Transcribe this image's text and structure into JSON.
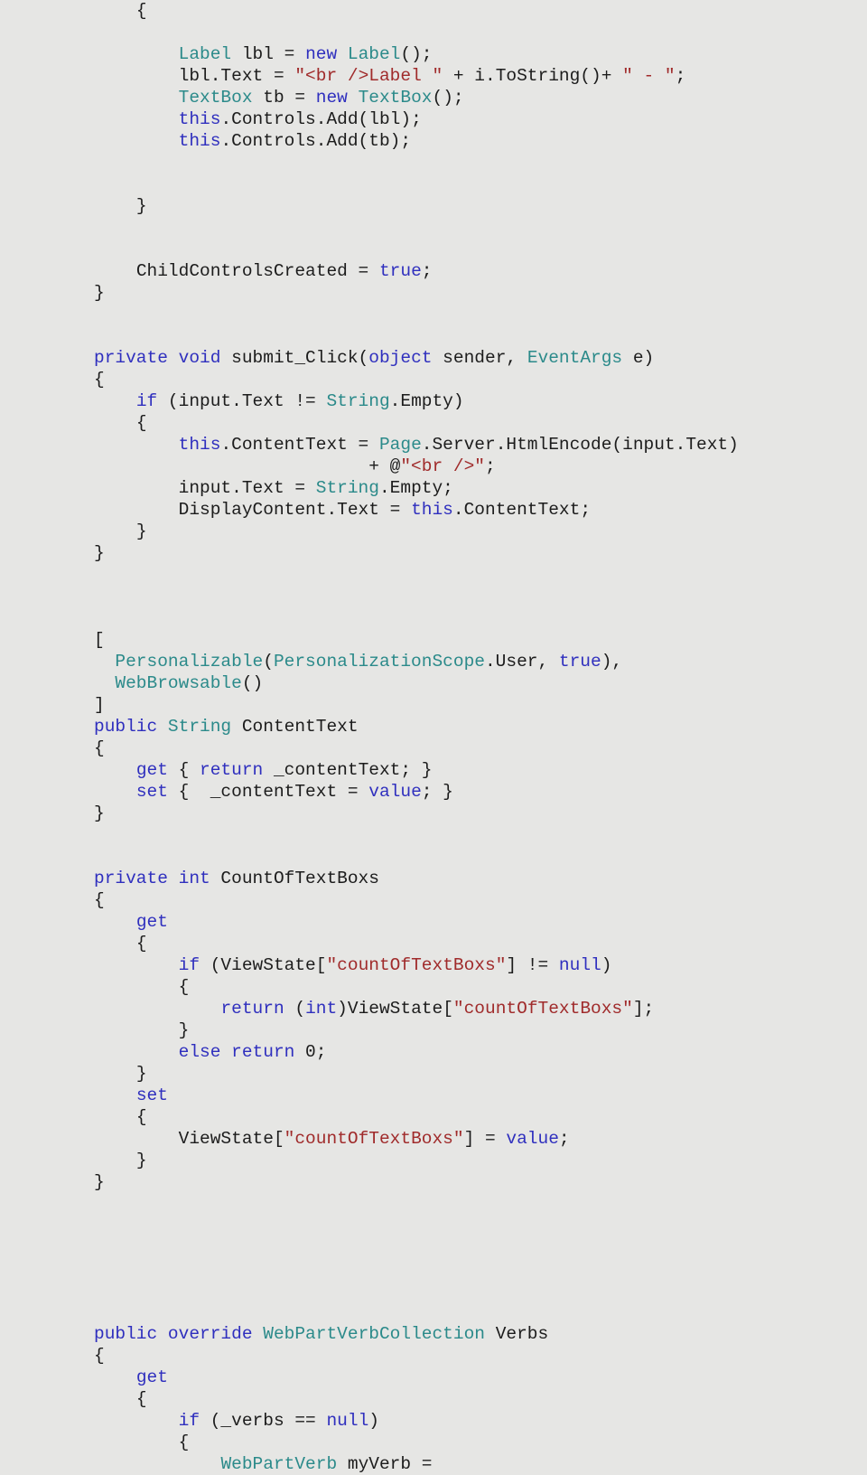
{
  "document": {
    "kind": "source-code-listing",
    "language": "C#",
    "background_color": "#e6e6e4",
    "colors": {
      "plain": "#1c1c1c",
      "keyword": "#2f2fbe",
      "type": "#2b8a8a",
      "string": "#a02b2b"
    }
  },
  "code": {
    "lines": [
      {
        "indent": 4,
        "tokens": [
          {
            "t": "{",
            "c": "plain"
          }
        ]
      },
      {
        "indent": 0,
        "tokens": []
      },
      {
        "indent": 8,
        "tokens": [
          {
            "t": "Label",
            "c": "type"
          },
          {
            "t": " lbl = ",
            "c": "plain"
          },
          {
            "t": "new",
            "c": "keyword"
          },
          {
            "t": " ",
            "c": "plain"
          },
          {
            "t": "Label",
            "c": "type"
          },
          {
            "t": "();",
            "c": "plain"
          }
        ]
      },
      {
        "indent": 8,
        "tokens": [
          {
            "t": "lbl.Text = ",
            "c": "plain"
          },
          {
            "t": "\"<br />Label \"",
            "c": "string"
          },
          {
            "t": " + i.ToString()+ ",
            "c": "plain"
          },
          {
            "t": "\" - \"",
            "c": "string"
          },
          {
            "t": ";",
            "c": "plain"
          }
        ]
      },
      {
        "indent": 8,
        "tokens": [
          {
            "t": "TextBox",
            "c": "type"
          },
          {
            "t": " tb = ",
            "c": "plain"
          },
          {
            "t": "new",
            "c": "keyword"
          },
          {
            "t": " ",
            "c": "plain"
          },
          {
            "t": "TextBox",
            "c": "type"
          },
          {
            "t": "();",
            "c": "plain"
          }
        ]
      },
      {
        "indent": 8,
        "tokens": [
          {
            "t": "this",
            "c": "keyword"
          },
          {
            "t": ".Controls.Add(lbl);",
            "c": "plain"
          }
        ]
      },
      {
        "indent": 8,
        "tokens": [
          {
            "t": "this",
            "c": "keyword"
          },
          {
            "t": ".Controls.Add(tb);",
            "c": "plain"
          }
        ]
      },
      {
        "indent": 0,
        "tokens": []
      },
      {
        "indent": 0,
        "tokens": []
      },
      {
        "indent": 4,
        "tokens": [
          {
            "t": "}",
            "c": "plain"
          }
        ]
      },
      {
        "indent": 0,
        "tokens": []
      },
      {
        "indent": 0,
        "tokens": []
      },
      {
        "indent": 4,
        "tokens": [
          {
            "t": "ChildControlsCreated = ",
            "c": "plain"
          },
          {
            "t": "true",
            "c": "keyword"
          },
          {
            "t": ";",
            "c": "plain"
          }
        ]
      },
      {
        "indent": 0,
        "tokens": [
          {
            "t": "}",
            "c": "plain"
          }
        ]
      },
      {
        "indent": 0,
        "tokens": []
      },
      {
        "indent": 0,
        "tokens": []
      },
      {
        "indent": 0,
        "tokens": [
          {
            "t": "private",
            "c": "keyword"
          },
          {
            "t": " ",
            "c": "plain"
          },
          {
            "t": "void",
            "c": "keyword"
          },
          {
            "t": " submit_Click(",
            "c": "plain"
          },
          {
            "t": "object",
            "c": "keyword"
          },
          {
            "t": " sender, ",
            "c": "plain"
          },
          {
            "t": "EventArgs",
            "c": "type"
          },
          {
            "t": " e)",
            "c": "plain"
          }
        ]
      },
      {
        "indent": 0,
        "tokens": [
          {
            "t": "{",
            "c": "plain"
          }
        ]
      },
      {
        "indent": 4,
        "tokens": [
          {
            "t": "if",
            "c": "keyword"
          },
          {
            "t": " (input.Text != ",
            "c": "plain"
          },
          {
            "t": "String",
            "c": "type"
          },
          {
            "t": ".Empty)",
            "c": "plain"
          }
        ]
      },
      {
        "indent": 4,
        "tokens": [
          {
            "t": "{",
            "c": "plain"
          }
        ]
      },
      {
        "indent": 8,
        "tokens": [
          {
            "t": "this",
            "c": "keyword"
          },
          {
            "t": ".ContentText = ",
            "c": "plain"
          },
          {
            "t": "Page",
            "c": "type"
          },
          {
            "t": ".Server.HtmlEncode(input.Text)",
            "c": "plain"
          }
        ]
      },
      {
        "indent": 26,
        "tokens": [
          {
            "t": "+ @",
            "c": "plain"
          },
          {
            "t": "\"<br />\"",
            "c": "string"
          },
          {
            "t": ";",
            "c": "plain"
          }
        ]
      },
      {
        "indent": 8,
        "tokens": [
          {
            "t": "input.Text = ",
            "c": "plain"
          },
          {
            "t": "String",
            "c": "type"
          },
          {
            "t": ".Empty;",
            "c": "plain"
          }
        ]
      },
      {
        "indent": 8,
        "tokens": [
          {
            "t": "DisplayContent.Text = ",
            "c": "plain"
          },
          {
            "t": "this",
            "c": "keyword"
          },
          {
            "t": ".ContentText;",
            "c": "plain"
          }
        ]
      },
      {
        "indent": 4,
        "tokens": [
          {
            "t": "}",
            "c": "plain"
          }
        ]
      },
      {
        "indent": 0,
        "tokens": [
          {
            "t": "}",
            "c": "plain"
          }
        ]
      },
      {
        "indent": 0,
        "tokens": []
      },
      {
        "indent": 0,
        "tokens": []
      },
      {
        "indent": 0,
        "tokens": []
      },
      {
        "indent": 0,
        "tokens": [
          {
            "t": "[",
            "c": "plain"
          }
        ]
      },
      {
        "indent": 2,
        "tokens": [
          {
            "t": "Personalizable",
            "c": "type"
          },
          {
            "t": "(",
            "c": "plain"
          },
          {
            "t": "PersonalizationScope",
            "c": "type"
          },
          {
            "t": ".User, ",
            "c": "plain"
          },
          {
            "t": "true",
            "c": "keyword"
          },
          {
            "t": "),",
            "c": "plain"
          }
        ]
      },
      {
        "indent": 2,
        "tokens": [
          {
            "t": "WebBrowsable",
            "c": "type"
          },
          {
            "t": "()",
            "c": "plain"
          }
        ]
      },
      {
        "indent": 0,
        "tokens": [
          {
            "t": "]",
            "c": "plain"
          }
        ]
      },
      {
        "indent": 0,
        "tokens": [
          {
            "t": "public",
            "c": "keyword"
          },
          {
            "t": " ",
            "c": "plain"
          },
          {
            "t": "String",
            "c": "type"
          },
          {
            "t": " ContentText",
            "c": "plain"
          }
        ]
      },
      {
        "indent": 0,
        "tokens": [
          {
            "t": "{",
            "c": "plain"
          }
        ]
      },
      {
        "indent": 4,
        "tokens": [
          {
            "t": "get",
            "c": "keyword"
          },
          {
            "t": " { ",
            "c": "plain"
          },
          {
            "t": "return",
            "c": "keyword"
          },
          {
            "t": " _contentText; }",
            "c": "plain"
          }
        ]
      },
      {
        "indent": 4,
        "tokens": [
          {
            "t": "set",
            "c": "keyword"
          },
          {
            "t": " {  _contentText = ",
            "c": "plain"
          },
          {
            "t": "value",
            "c": "keyword"
          },
          {
            "t": "; }",
            "c": "plain"
          }
        ]
      },
      {
        "indent": 0,
        "tokens": [
          {
            "t": "}",
            "c": "plain"
          }
        ]
      },
      {
        "indent": 0,
        "tokens": []
      },
      {
        "indent": 0,
        "tokens": []
      },
      {
        "indent": 0,
        "tokens": [
          {
            "t": "private",
            "c": "keyword"
          },
          {
            "t": " ",
            "c": "plain"
          },
          {
            "t": "int",
            "c": "keyword"
          },
          {
            "t": " CountOfTextBoxs",
            "c": "plain"
          }
        ]
      },
      {
        "indent": 0,
        "tokens": [
          {
            "t": "{",
            "c": "plain"
          }
        ]
      },
      {
        "indent": 4,
        "tokens": [
          {
            "t": "get",
            "c": "keyword"
          }
        ]
      },
      {
        "indent": 4,
        "tokens": [
          {
            "t": "{",
            "c": "plain"
          }
        ]
      },
      {
        "indent": 8,
        "tokens": [
          {
            "t": "if",
            "c": "keyword"
          },
          {
            "t": " (ViewState[",
            "c": "plain"
          },
          {
            "t": "\"countOfTextBoxs\"",
            "c": "string"
          },
          {
            "t": "] != ",
            "c": "plain"
          },
          {
            "t": "null",
            "c": "keyword"
          },
          {
            "t": ")",
            "c": "plain"
          }
        ]
      },
      {
        "indent": 8,
        "tokens": [
          {
            "t": "{",
            "c": "plain"
          }
        ]
      },
      {
        "indent": 12,
        "tokens": [
          {
            "t": "return",
            "c": "keyword"
          },
          {
            "t": " (",
            "c": "plain"
          },
          {
            "t": "int",
            "c": "keyword"
          },
          {
            "t": ")ViewState[",
            "c": "plain"
          },
          {
            "t": "\"countOfTextBoxs\"",
            "c": "string"
          },
          {
            "t": "];",
            "c": "plain"
          }
        ]
      },
      {
        "indent": 8,
        "tokens": [
          {
            "t": "}",
            "c": "plain"
          }
        ]
      },
      {
        "indent": 8,
        "tokens": [
          {
            "t": "else",
            "c": "keyword"
          },
          {
            "t": " ",
            "c": "plain"
          },
          {
            "t": "return",
            "c": "keyword"
          },
          {
            "t": " 0;",
            "c": "plain"
          }
        ]
      },
      {
        "indent": 4,
        "tokens": [
          {
            "t": "}",
            "c": "plain"
          }
        ]
      },
      {
        "indent": 4,
        "tokens": [
          {
            "t": "set",
            "c": "keyword"
          }
        ]
      },
      {
        "indent": 4,
        "tokens": [
          {
            "t": "{",
            "c": "plain"
          }
        ]
      },
      {
        "indent": 8,
        "tokens": [
          {
            "t": "ViewState[",
            "c": "plain"
          },
          {
            "t": "\"countOfTextBoxs\"",
            "c": "string"
          },
          {
            "t": "] = ",
            "c": "plain"
          },
          {
            "t": "value",
            "c": "keyword"
          },
          {
            "t": ";",
            "c": "plain"
          }
        ]
      },
      {
        "indent": 4,
        "tokens": [
          {
            "t": "}",
            "c": "plain"
          }
        ]
      },
      {
        "indent": 0,
        "tokens": [
          {
            "t": "}",
            "c": "plain"
          }
        ]
      },
      {
        "indent": 0,
        "tokens": []
      },
      {
        "indent": 0,
        "tokens": []
      },
      {
        "indent": 0,
        "tokens": []
      },
      {
        "indent": 0,
        "tokens": []
      },
      {
        "indent": 0,
        "tokens": []
      },
      {
        "indent": 0,
        "tokens": []
      },
      {
        "indent": 0,
        "tokens": [
          {
            "t": "public",
            "c": "keyword"
          },
          {
            "t": " ",
            "c": "plain"
          },
          {
            "t": "override",
            "c": "keyword"
          },
          {
            "t": " ",
            "c": "plain"
          },
          {
            "t": "WebPartVerbCollection",
            "c": "type"
          },
          {
            "t": " Verbs",
            "c": "plain"
          }
        ]
      },
      {
        "indent": 0,
        "tokens": [
          {
            "t": "{",
            "c": "plain"
          }
        ]
      },
      {
        "indent": 4,
        "tokens": [
          {
            "t": "get",
            "c": "keyword"
          }
        ]
      },
      {
        "indent": 4,
        "tokens": [
          {
            "t": "{",
            "c": "plain"
          }
        ]
      },
      {
        "indent": 8,
        "tokens": [
          {
            "t": "if",
            "c": "keyword"
          },
          {
            "t": " (_verbs == ",
            "c": "plain"
          },
          {
            "t": "null",
            "c": "keyword"
          },
          {
            "t": ")",
            "c": "plain"
          }
        ]
      },
      {
        "indent": 8,
        "tokens": [
          {
            "t": "{",
            "c": "plain"
          }
        ]
      },
      {
        "indent": 12,
        "tokens": [
          {
            "t": "WebPartVerb",
            "c": "type"
          },
          {
            "t": " myVerb =",
            "c": "plain"
          }
        ]
      }
    ]
  }
}
